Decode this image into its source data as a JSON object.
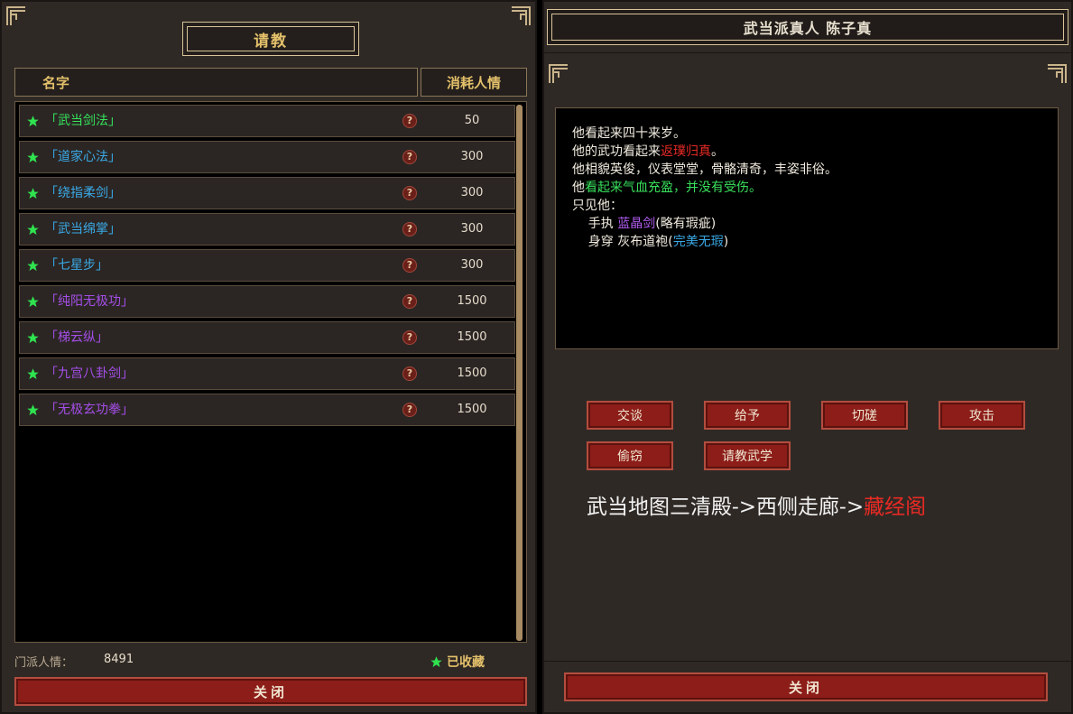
{
  "left_panel": {
    "title": "请教",
    "columns": {
      "name": "名字",
      "cost": "消耗人情"
    },
    "skills": [
      {
        "name": "「武当剑法」",
        "cost": "50",
        "color": "#35e35a"
      },
      {
        "name": "「道家心法」",
        "cost": "300",
        "color": "#3aa9e6"
      },
      {
        "name": "「绕指柔剑」",
        "cost": "300",
        "color": "#3aa9e6"
      },
      {
        "name": "「武当绵掌」",
        "cost": "300",
        "color": "#3aa9e6"
      },
      {
        "name": "「七星步」",
        "cost": "300",
        "color": "#3aa9e6"
      },
      {
        "name": "「纯阳无极功」",
        "cost": "1500",
        "color": "#a54ee8"
      },
      {
        "name": "「梯云纵」",
        "cost": "1500",
        "color": "#a54ee8"
      },
      {
        "name": "「九宫八卦剑」",
        "cost": "1500",
        "color": "#a54ee8"
      },
      {
        "name": "「无极玄功拳」",
        "cost": "1500",
        "color": "#a54ee8"
      }
    ],
    "sect_favor_label": "门派人情：",
    "sect_favor_value": "8491",
    "favorited_label": "已收藏",
    "close_label": "关闭"
  },
  "right_panel": {
    "title": "武当派真人 陈子真",
    "description": {
      "line1": "他看起来四十来岁。",
      "line2_a": "他的武功看起来",
      "line2_b": "返璞归真",
      "line2_c": "。",
      "line3": "他相貌英俊，仪表堂堂，骨骼清奇，丰姿非俗。",
      "line4_a": "他",
      "line4_b": "看起来气血充盈，并没有受伤。",
      "line5": "只见他：",
      "line6_a": "    手执 ",
      "line6_b": "蓝晶剑",
      "line6_c": "(略有瑕疵)",
      "line7_a": "    身穿 灰布道袍(",
      "line7_b": "完美无瑕",
      "line7_c": ")"
    },
    "actions": [
      "交谈",
      "给予",
      "切磋",
      "攻击",
      "偷窃",
      "请教武学"
    ],
    "route_a": "武当地图三清殿->西侧走廊->",
    "route_b": "藏经阁",
    "close_label": "关闭"
  },
  "colors": {
    "gold": "#e3c06a",
    "panel_bg": "#2f2925",
    "button_red": "#8c1d18",
    "star_green": "#2fe34f"
  }
}
